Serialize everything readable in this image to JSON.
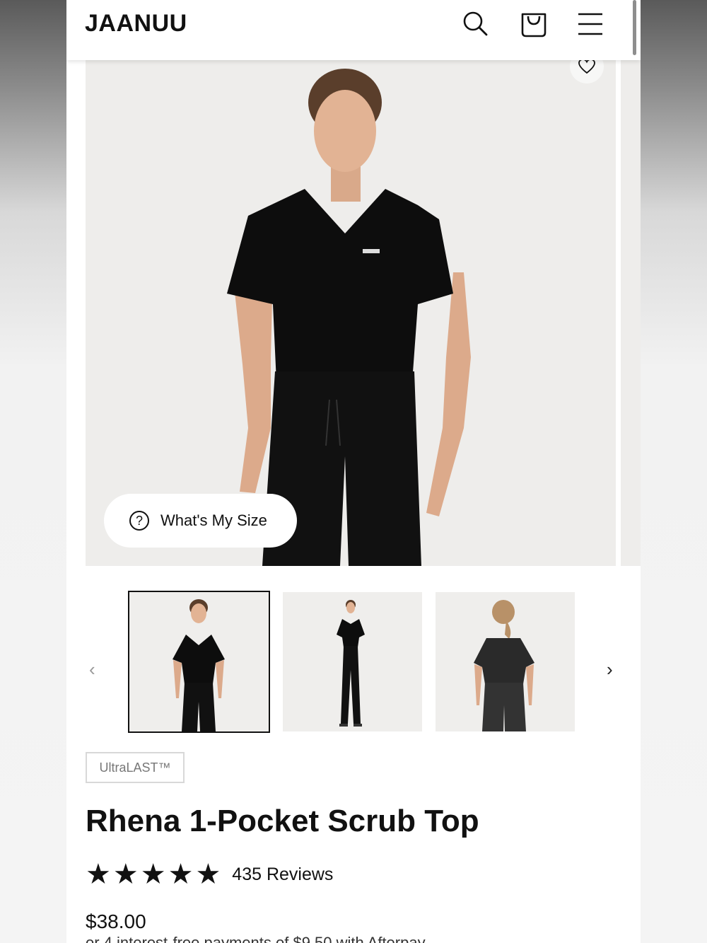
{
  "header": {
    "logo": "JAANUU",
    "search_icon": "search-icon",
    "bag_icon": "shopping-bag-icon",
    "menu_icon": "hamburger-menu-icon"
  },
  "hero": {
    "size_button_label": "What's My Size",
    "favorite_icon": "heart-icon",
    "help_icon": "question-circle-icon"
  },
  "thumbnails": {
    "prev_icon": "chevron-left-icon",
    "next_icon": "chevron-right-icon",
    "items": [
      {
        "name": "front-view",
        "active": true
      },
      {
        "name": "full-body-view",
        "active": false
      },
      {
        "name": "back-view",
        "active": false
      }
    ]
  },
  "product": {
    "badge": "UltraLAST™",
    "title": "Rhena 1-Pocket Scrub Top",
    "rating_stars": 5,
    "reviews": "435 Reviews",
    "price": "$38.00",
    "afterpay_text": "or 4 interest-free payments of $9.50 with Afterpay"
  },
  "colors": {
    "scrub": "#0d0d0d",
    "hero_bg": "#eeedeb"
  }
}
